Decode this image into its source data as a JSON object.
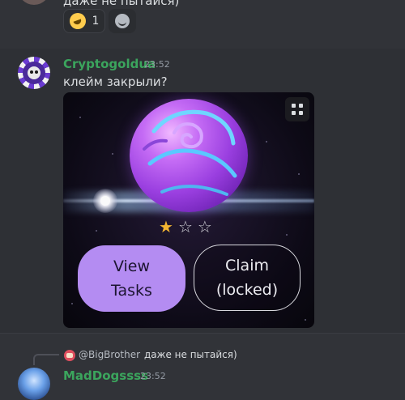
{
  "previous_message": {
    "text": "даже не пытайся)",
    "reactions": [
      {
        "emoji": "rolling-on-floor-laughing",
        "count": "1"
      },
      {
        "emoji": "add-reaction",
        "count": ""
      }
    ]
  },
  "message": {
    "username": "Cryptogoldua",
    "username_color": "#3ba55d",
    "timestamp": "23:52",
    "content": "клейм закрыли?",
    "embed": {
      "rating": {
        "filled": 1,
        "total": 3
      },
      "buttons": {
        "view_tasks": "View\nTasks",
        "claim": "Claim\n(locked)"
      },
      "accent_color": "#b48cf2"
    }
  },
  "reply_message": {
    "reply_to_user": "@BigBrother",
    "reply_to_text": "даже не пытайся)",
    "username": "MadDogssss",
    "timestamp": "23:52"
  }
}
